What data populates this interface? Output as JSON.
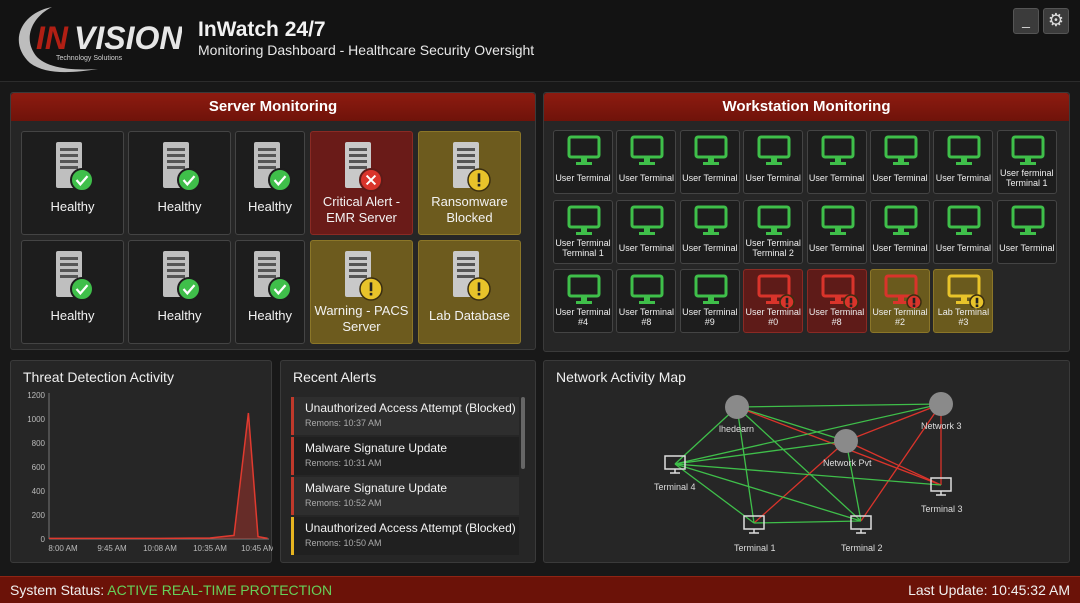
{
  "header": {
    "logo_text": "INVISION",
    "logo_sub": "Technology Solutions",
    "title": "InWatch 24/7",
    "subtitle": "Monitoring Dashboard - Healthcare Security Oversight",
    "minimize_label": "_",
    "settings_icon": "gear-icon"
  },
  "server_panel": {
    "title": "Server Monitoring",
    "servers": [
      {
        "label": "Healthy",
        "status": "ok"
      },
      {
        "label": "Healthy",
        "status": "ok"
      },
      {
        "label": "Healthy",
        "status": "ok"
      },
      {
        "label": "Critical Alert - EMR Server",
        "status": "critical"
      },
      {
        "label": "Ransomware Blocked",
        "status": "warning"
      },
      {
        "label": "Healthy",
        "status": "ok"
      },
      {
        "label": "Healthy",
        "status": "ok"
      },
      {
        "label": "Healthy",
        "status": "ok"
      },
      {
        "label": "Warning - PACS Server",
        "status": "warning"
      },
      {
        "label": "Lab Database",
        "status": "warning"
      }
    ]
  },
  "workstation_panel": {
    "title": "Workstation Monitoring",
    "rows": [
      [
        {
          "label": "User Terminal",
          "status": "ok"
        },
        {
          "label": "User Terminal",
          "status": "ok"
        },
        {
          "label": "User Terminal",
          "status": "ok"
        },
        {
          "label": "User Terminal",
          "status": "ok"
        },
        {
          "label": "User Terminal",
          "status": "ok"
        },
        {
          "label": "User Terminal",
          "status": "ok"
        },
        {
          "label": "User Terminal",
          "status": "ok"
        },
        {
          "label": "User ferminal Terminal 1",
          "status": "ok"
        }
      ],
      [
        {
          "label": "User Terminal Terminal 1",
          "status": "ok"
        },
        {
          "label": "User Terminal",
          "status": "ok"
        },
        {
          "label": "User Terminal",
          "status": "ok"
        },
        {
          "label": "User Terminal Terminal 2",
          "status": "ok"
        },
        {
          "label": "User Terminal",
          "status": "ok"
        },
        {
          "label": "User Terminal",
          "status": "ok"
        },
        {
          "label": "User Terminal",
          "status": "ok"
        },
        {
          "label": "User Terminal",
          "status": "ok"
        }
      ],
      [
        {
          "label": "User Terminal #4",
          "status": "ok"
        },
        {
          "label": "User Terminal #8",
          "status": "ok"
        },
        {
          "label": "User Terminal #9",
          "status": "ok"
        },
        {
          "label": "User Terminal #0",
          "status": "critical"
        },
        {
          "label": "User Terminal #8",
          "status": "critical"
        },
        {
          "label": "User Terminal #2",
          "status": "critical-warn"
        },
        {
          "label": "Lab Terminal #3",
          "status": "warning"
        }
      ]
    ]
  },
  "threat_chart": {
    "title": "Threat Detection Activity",
    "chart_data": {
      "type": "line",
      "title": "Threat Detection Activity",
      "xlabel": "",
      "ylabel": "",
      "x_ticks": [
        "8:00 AM",
        "9:45 AM",
        "10:08 AM",
        "10:35 AM",
        "10:45 AM"
      ],
      "y_ticks": [
        "0",
        "200",
        "400",
        "600",
        "800",
        "1000",
        "1200"
      ],
      "ylim": [
        0,
        1200
      ],
      "series": [
        {
          "color": "#e03a2f",
          "points": [
            {
              "x": "8:00 AM",
              "y": 5
            },
            {
              "x": "9:45 AM",
              "y": 5
            },
            {
              "x": "10:08 AM",
              "y": 5
            },
            {
              "x": "10:35 AM",
              "y": 8
            },
            {
              "x": "10:40 AM",
              "y": 30
            },
            {
              "x": "10:43 AM",
              "y": 1050
            },
            {
              "x": "10:45 AM",
              "y": 20
            },
            {
              "x": "10:47 AM",
              "y": 5
            }
          ]
        }
      ],
      "grid": false
    }
  },
  "alerts": {
    "title": "Recent Alerts",
    "items": [
      {
        "title": "Unauthorized Access Attempt (Blocked)",
        "time": "Remons: 10:37 AM",
        "color": "red"
      },
      {
        "title": "Malware Signature Update",
        "time": "Remons: 10:31 AM",
        "color": "red"
      },
      {
        "title": "Malware Signature Update",
        "time": "Remons: 10:52 AM",
        "color": "red"
      },
      {
        "title": "Unauthorized Access Attempt (Blocked)",
        "time": "Remons: 10:50 AM",
        "color": "yellow"
      }
    ]
  },
  "network": {
    "title": "Network Activity Map",
    "nodes": {
      "hub_left": "lhedearn",
      "hub_mid": "Network Pvt",
      "hub_right": "Network 3",
      "t4": "Terminal 4",
      "t1": "Terminal 1",
      "t2": "Terminal 2",
      "t3": "Terminal 3"
    }
  },
  "status_bar": {
    "prefix": "System Status:",
    "status": "ACTIVE REAL-TIME PROTECTION",
    "last_update": "Last Update: 10:45:32 AM"
  },
  "colors": {
    "ok": "#3fbf4a",
    "critical": "#d9342b",
    "warning": "#e8c32a",
    "brand_red": "#8e1b10"
  }
}
